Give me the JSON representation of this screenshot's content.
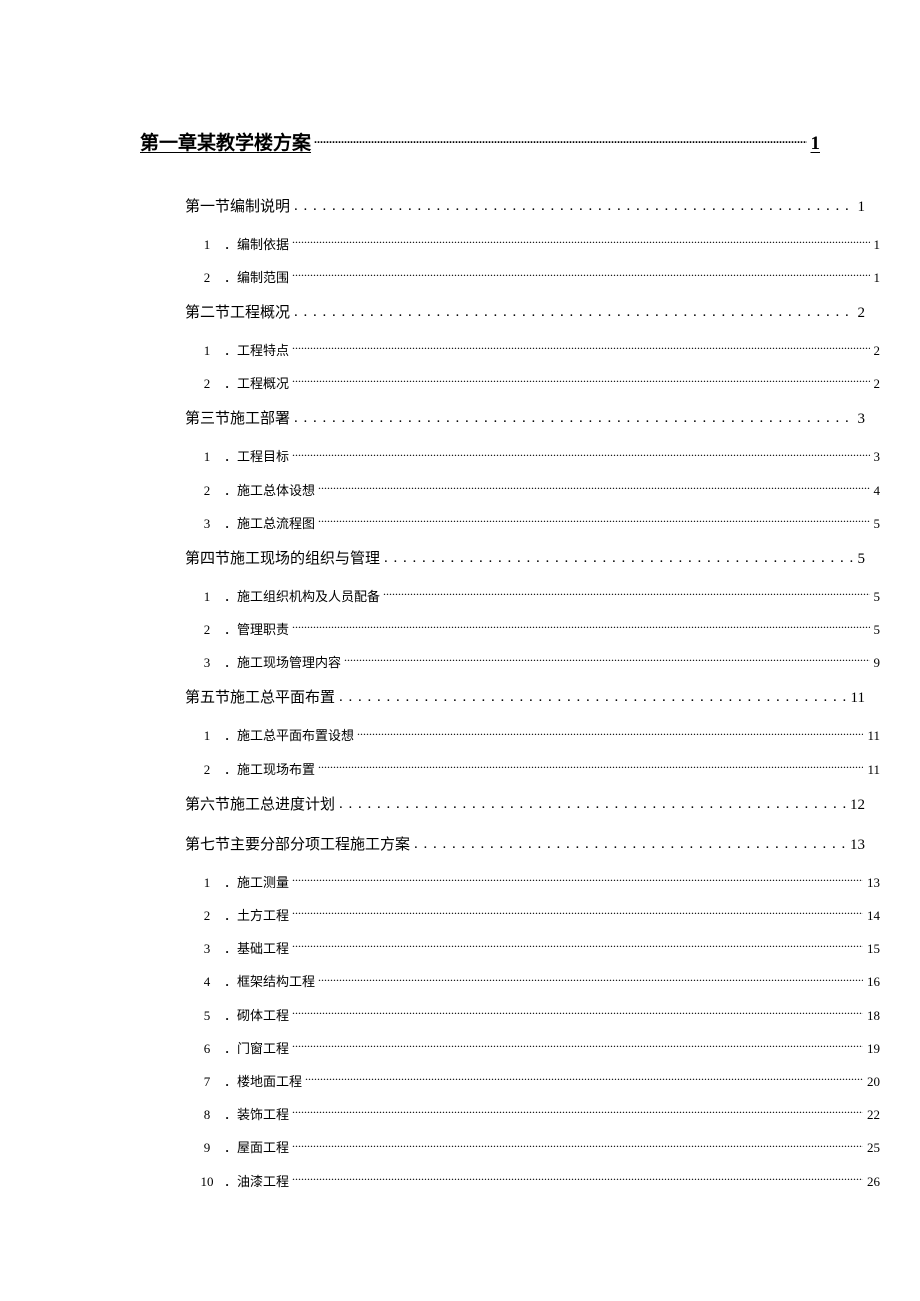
{
  "toc": {
    "chapter": {
      "title": "第一章某教学楼方案",
      "page": "1"
    },
    "s1": {
      "title": "第一节编制说明",
      "page": "1",
      "i1": {
        "num": "1",
        "title": "．编制依据",
        "page": "1"
      },
      "i2": {
        "num": "2",
        "title": "．编制范围",
        "page": "1"
      }
    },
    "s2": {
      "title": "第二节工程概况",
      "page": "2",
      "i1": {
        "num": "1",
        "title": "．工程特点",
        "page": "2"
      },
      "i2": {
        "num": "2",
        "title": "．工程概况",
        "page": "2"
      }
    },
    "s3": {
      "title": "第三节施工部署",
      "page": "3",
      "i1": {
        "num": "1",
        "title": "．工程目标",
        "page": "3"
      },
      "i2": {
        "num": "2",
        "title": "．施工总体设想",
        "page": "4"
      },
      "i3": {
        "num": "3",
        "title": "．施工总流程图",
        "page": "5"
      }
    },
    "s4": {
      "title": "第四节施工现场的组织与管理",
      "page": "5",
      "i1": {
        "num": "1",
        "title": "．施工组织机构及人员配备",
        "page": "5"
      },
      "i2": {
        "num": "2",
        "title": "．管理职责",
        "page": "5"
      },
      "i3": {
        "num": "3",
        "title": "．施工现场管理内容",
        "page": "9"
      }
    },
    "s5": {
      "title": "第五节施工总平面布置",
      "page": "11",
      "i1": {
        "num": "1",
        "title": "．施工总平面布置设想",
        "page": "11"
      },
      "i2": {
        "num": "2",
        "title": "．施工现场布置",
        "page": "11"
      }
    },
    "s6": {
      "title": "第六节施工总进度计划",
      "page": "12"
    },
    "s7": {
      "title": "第七节主要分部分项工程施工方案",
      "page": "13",
      "i1": {
        "num": "1",
        "title": "．施工测量",
        "page": "13"
      },
      "i2": {
        "num": "2",
        "title": "．土方工程",
        "page": "14"
      },
      "i3": {
        "num": "3",
        "title": "．基础工程",
        "page": "15"
      },
      "i4": {
        "num": "4",
        "title": "．框架结构工程",
        "page": "16"
      },
      "i5": {
        "num": "5",
        "title": "．砌体工程",
        "page": "18"
      },
      "i6": {
        "num": "6",
        "title": "．门窗工程",
        "page": "19"
      },
      "i7": {
        "num": "7",
        "title": "．楼地面工程",
        "page": "20"
      },
      "i8": {
        "num": "8",
        "title": "．装饰工程",
        "page": "22"
      },
      "i9": {
        "num": "9",
        "title": "．屋面工程",
        "page": "25"
      },
      "i10": {
        "num": "10",
        "title": "．油漆工程",
        "page": "26"
      }
    }
  }
}
